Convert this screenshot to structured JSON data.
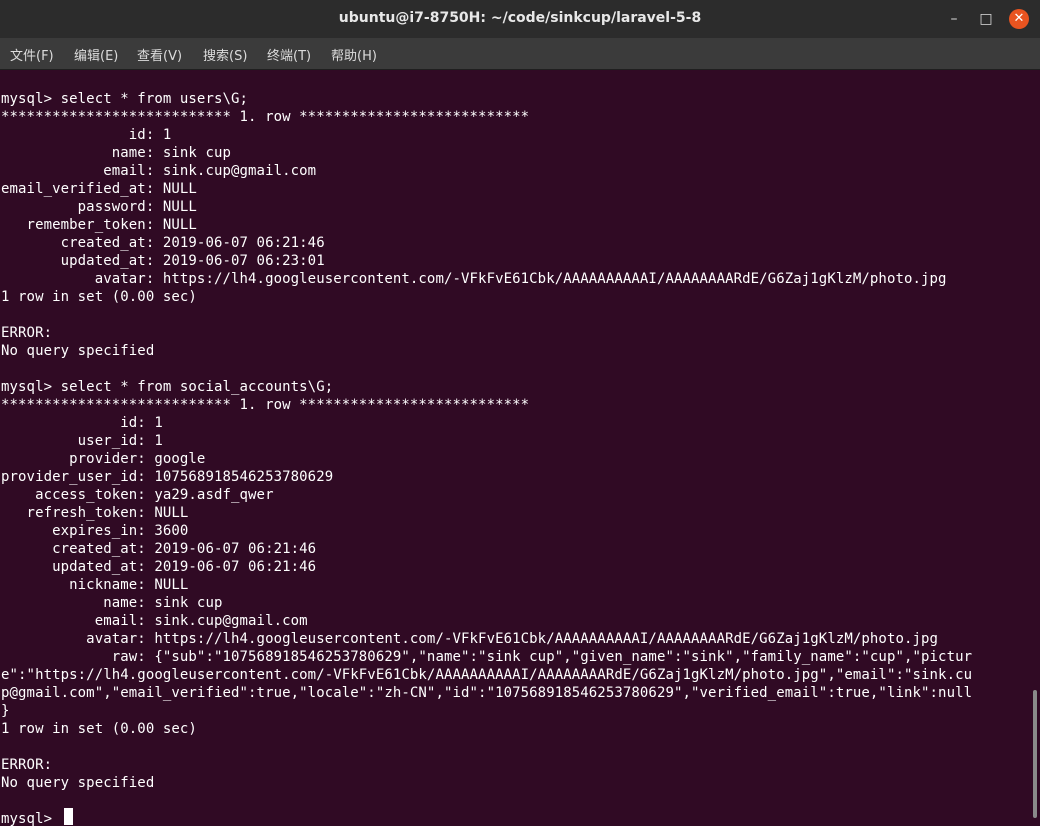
{
  "window": {
    "title": "ubuntu@i7-8750H: ~/code/sinkcup/laravel-5-8",
    "minimize_icon": "minimize-icon",
    "maximize_icon": "maximize-icon",
    "close_icon": "close-icon"
  },
  "menu": [
    "文件(F)",
    "编辑(E)",
    "查看(V)",
    "搜索(S)",
    "终端(T)",
    "帮助(H)"
  ],
  "terminal": {
    "lines": [
      "",
      "mysql> select * from users\\G;",
      "*************************** 1. row ***************************",
      "               id: 1",
      "             name: sink cup",
      "            email: sink.cup@gmail.com",
      "email_verified_at: NULL",
      "         password: NULL",
      "   remember_token: NULL",
      "       created_at: 2019-06-07 06:21:46",
      "       updated_at: 2019-06-07 06:23:01",
      "           avatar: https://lh4.googleusercontent.com/-VFkFvE61Cbk/AAAAAAAAAAI/AAAAAAAARdE/G6Zaj1gKlzM/photo.jpg",
      "1 row in set (0.00 sec)",
      "",
      "ERROR:",
      "No query specified",
      "",
      "mysql> select * from social_accounts\\G;",
      "*************************** 1. row ***************************",
      "              id: 1",
      "         user_id: 1",
      "        provider: google",
      "provider_user_id: 107568918546253780629",
      "    access_token: ya29.asdf_qwer",
      "   refresh_token: NULL",
      "      expires_in: 3600",
      "      created_at: 2019-06-07 06:21:46",
      "      updated_at: 2019-06-07 06:21:46",
      "        nickname: NULL",
      "            name: sink cup",
      "           email: sink.cup@gmail.com",
      "          avatar: https://lh4.googleusercontent.com/-VFkFvE61Cbk/AAAAAAAAAAI/AAAAAAAARdE/G6Zaj1gKlzM/photo.jpg",
      "             raw: {\"sub\":\"107568918546253780629\",\"name\":\"sink cup\",\"given_name\":\"sink\",\"family_name\":\"cup\",\"pictur",
      "e\":\"https://lh4.googleusercontent.com/-VFkFvE61Cbk/AAAAAAAAAAI/AAAAAAAARdE/G6Zaj1gKlzM/photo.jpg\",\"email\":\"sink.cu",
      "p@gmail.com\",\"email_verified\":true,\"locale\":\"zh-CN\",\"id\":\"107568918546253780629\",\"verified_email\":true,\"link\":null",
      "}",
      "1 row in set (0.00 sec)",
      "",
      "ERROR:",
      "No query specified",
      "",
      "mysql> "
    ]
  },
  "colors": {
    "terminal_background": "#300a24",
    "terminal_text": "#ffffff",
    "titlebar": "#2c2c2c",
    "close_button": "#e95420"
  }
}
